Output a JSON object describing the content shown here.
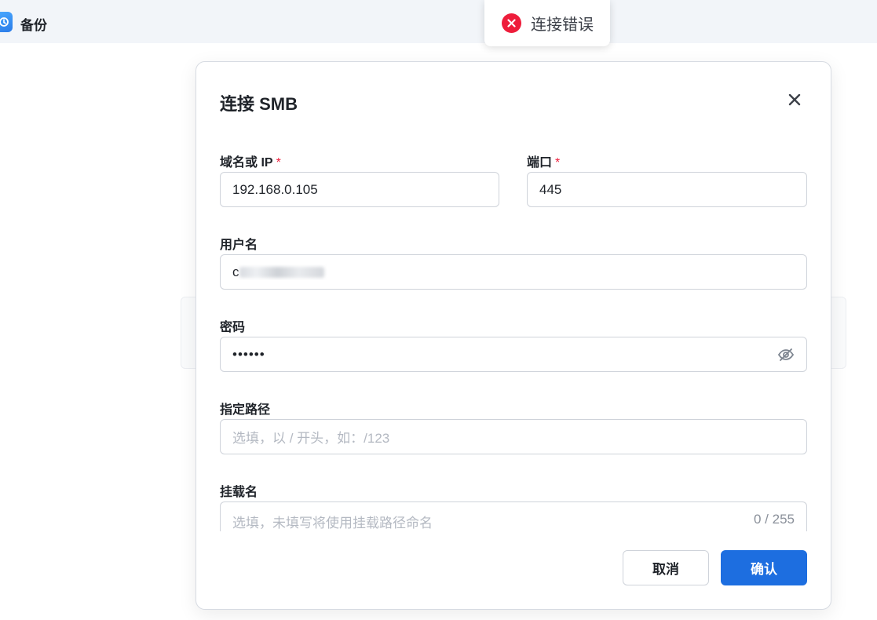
{
  "app": {
    "title": "备份",
    "icon": "backup-app-icon"
  },
  "toast": {
    "icon": "error-circle-icon",
    "text": "连接错误",
    "color": "#ee1d3b"
  },
  "dialog": {
    "title": "连接 SMB",
    "close_icon": "close-icon",
    "fields": {
      "host": {
        "label": "域名或 IP",
        "required": "*",
        "value": "192.168.0.105"
      },
      "port": {
        "label": "端口",
        "required": "*",
        "value": "445"
      },
      "username": {
        "label": "用户名",
        "value_prefix": "c"
      },
      "password": {
        "label": "密码",
        "value": "••••••",
        "toggle_icon": "eye-off-icon"
      },
      "path": {
        "label": "指定路径",
        "placeholder": "选填，以 / 开头，如：/123"
      },
      "mount_name": {
        "label": "挂载名",
        "placeholder": "选填，未填写将使用挂载路径命名",
        "counter": "0 / 255"
      }
    },
    "buttons": {
      "cancel": "取消",
      "confirm": "确认"
    }
  },
  "colors": {
    "primary": "#1d6ee0",
    "error": "#ee1d3b"
  }
}
